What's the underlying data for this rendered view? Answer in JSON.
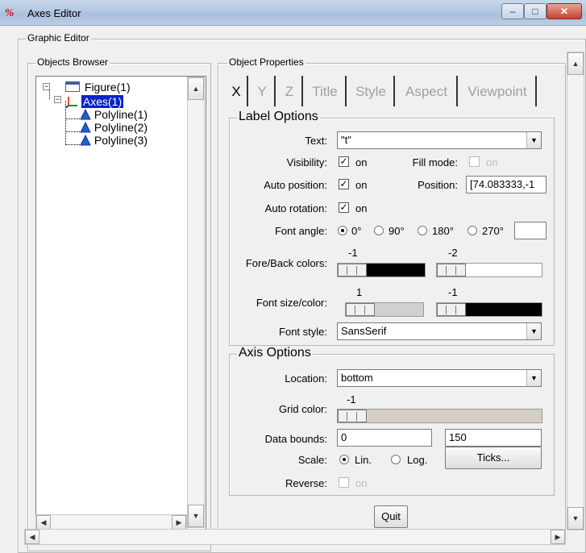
{
  "window": {
    "icon": "scilab-logo",
    "title": "Axes Editor",
    "minimize": "–",
    "maximize": "□",
    "close": "✕"
  },
  "graphic_editor": {
    "title": "Graphic Editor"
  },
  "objects_browser": {
    "title": "Objects Browser",
    "tree": [
      {
        "label": "Figure(1)",
        "icon": "figure-window-icon",
        "selected": false
      },
      {
        "label": "Axes(1)",
        "icon": "axes-icon",
        "selected": true
      },
      {
        "label": "Polyline(1)",
        "icon": "polyline-icon",
        "selected": false
      },
      {
        "label": "Polyline(2)",
        "icon": "polyline-icon",
        "selected": false
      },
      {
        "label": "Polyline(3)",
        "icon": "polyline-icon",
        "selected": false
      }
    ]
  },
  "object_properties": {
    "title": "Object Properties",
    "tabs": [
      {
        "label": "X",
        "active": true
      },
      {
        "label": "Y",
        "active": false
      },
      {
        "label": "Z",
        "active": false
      },
      {
        "label": "Title",
        "active": false
      },
      {
        "label": "Style",
        "active": false
      },
      {
        "label": "Aspect",
        "active": false
      },
      {
        "label": "Viewpoint",
        "active": false
      }
    ],
    "label_options": {
      "title": "Label Options",
      "text_label": "Text:",
      "text_value": "\"t\"",
      "visibility_label": "Visibility:",
      "visibility_on": "on",
      "visibility_checked": true,
      "fill_mode_label": "Fill mode:",
      "fill_mode_on": "on",
      "fill_mode_checked": false,
      "auto_position_label": "Auto position:",
      "auto_position_on": "on",
      "auto_position_checked": true,
      "position_label": "Position:",
      "position_value": "[74.083333,-1",
      "auto_rotation_label": "Auto rotation:",
      "auto_rotation_on": "on",
      "auto_rotation_checked": true,
      "font_angle_label": "Font angle:",
      "font_angle_options": [
        "0°",
        "90°",
        "180°",
        "270°"
      ],
      "font_angle_selected": "0°",
      "font_angle_custom": "",
      "fore_back_label": "Fore/Back colors:",
      "fore_color_value": "-1",
      "fore_color": "#000000",
      "back_color_value": "-2",
      "back_color": "#ffffff",
      "font_size_color_label": "Font size/color:",
      "font_size_value": "1",
      "font_color_value": "-1",
      "font_color": "#000000",
      "font_style_label": "Font style:",
      "font_style_value": "SansSerif"
    },
    "axis_options": {
      "title": "Axis Options",
      "location_label": "Location:",
      "location_value": "bottom",
      "grid_color_label": "Grid color:",
      "grid_color_value": "-1",
      "data_bounds_label": "Data bounds:",
      "data_bounds_min": "0",
      "data_bounds_max": "150",
      "scale_label": "Scale:",
      "scale_options": [
        "Lin.",
        "Log."
      ],
      "scale_selected": "Lin.",
      "ticks_button": "Ticks...",
      "reverse_label": "Reverse:",
      "reverse_on": "on",
      "reverse_checked": false
    },
    "quit_button": "Quit"
  },
  "colors": {
    "selection": "#0a24c8",
    "title_bar": "#b9cbe3",
    "close_button": "#c7412e"
  }
}
